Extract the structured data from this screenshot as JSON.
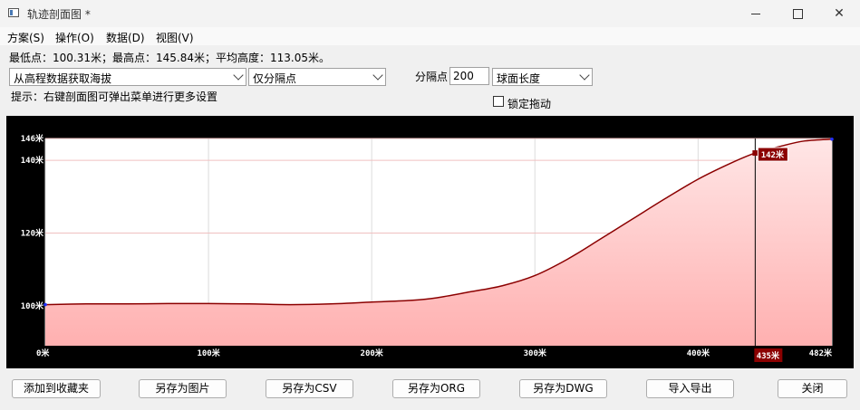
{
  "window": {
    "title": "轨迹剖面图 *"
  },
  "menu": [
    "方案(S)",
    "操作(O)",
    "数据(D)",
    "视图(V)"
  ],
  "stats": "最低点：100.31米；最高点：145.84米；平均高度：113.05米。",
  "controls": {
    "source_select": "从高程数据获取海拔",
    "mode_select": "仅分隔点",
    "interval_label": "分隔点",
    "interval_value": "200",
    "length_select": "球面长度",
    "hint": "提示：右键剖面图可弹出菜单进行更多设置",
    "lock_drag_label": "锁定拖动",
    "lock_drag_checked": false
  },
  "chart_data": {
    "type": "area",
    "x_unit": "米",
    "y_unit": "米",
    "xlim": [
      0,
      482
    ],
    "ylim": [
      89,
      146
    ],
    "y_ticks": [
      {
        "value": 146,
        "label": "146米"
      },
      {
        "value": 140,
        "label": "140米"
      },
      {
        "value": 120,
        "label": "120米"
      },
      {
        "value": 100,
        "label": "100米"
      }
    ],
    "x_ticks": [
      {
        "value": 0,
        "label": "0米"
      },
      {
        "value": 100,
        "label": "100米"
      },
      {
        "value": 200,
        "label": "200米"
      },
      {
        "value": 300,
        "label": "300米"
      },
      {
        "value": 400,
        "label": "400米"
      },
      {
        "value": 482,
        "label": "482米"
      }
    ],
    "x": [
      0,
      25,
      50,
      75,
      100,
      125,
      150,
      175,
      200,
      225,
      240,
      260,
      280,
      300,
      320,
      340,
      360,
      380,
      400,
      420,
      435,
      450,
      465,
      482
    ],
    "y": [
      100.3,
      100.5,
      100.5,
      100.6,
      100.6,
      100.5,
      100.3,
      100.5,
      101.0,
      101.5,
      102.2,
      103.8,
      105.5,
      108.3,
      112.8,
      118.3,
      123.9,
      129.5,
      134.8,
      139.2,
      142.0,
      143.8,
      145.3,
      145.8
    ],
    "grid": true,
    "cursor": {
      "x": 435,
      "y": 142,
      "x_label": "435米",
      "y_label": "142米"
    },
    "colors": {
      "line": "#8b0000",
      "fill_top": "#ffe6e6",
      "fill_bottom": "#ffb0b0",
      "panel": "#000000",
      "plot_bg": "#ffffff",
      "grid": "#dcdcdc",
      "label_box": "#8b0000"
    }
  },
  "buttons": {
    "favorite": "添加到收藏夹",
    "save_image": "另存为图片",
    "save_csv": "另存为CSV",
    "save_org": "另存为ORG",
    "save_dwg": "另存为DWG",
    "import_export": "导入导出",
    "close": "关闭"
  }
}
